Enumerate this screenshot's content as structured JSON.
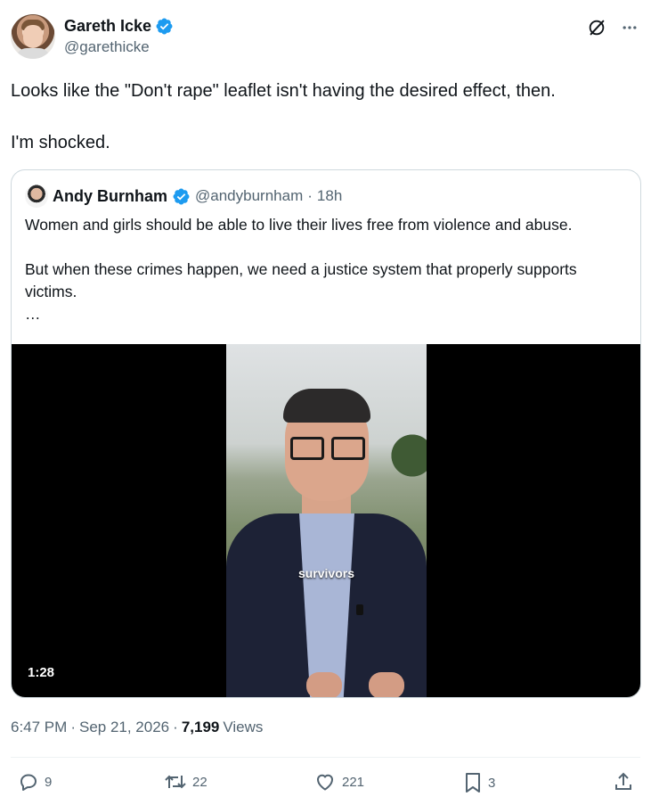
{
  "author": {
    "display_name": "Gareth Icke",
    "handle": "@garethicke"
  },
  "tweet": {
    "text": "Looks like the \"Don't rape\" leaflet isn't having the desired effect, then.\n\nI'm shocked."
  },
  "quoted": {
    "display_name": "Andy Burnham",
    "handle": "@andyburnham",
    "separator": "·",
    "age": "18h",
    "text": "Women and girls should be able to live their lives free from violence and abuse.\n\nBut when these crimes happen, we need a justice system that properly supports victims.\n…",
    "video": {
      "caption": "survivors",
      "duration": "1:28"
    }
  },
  "meta": {
    "time": "6:47 PM",
    "dot1": "·",
    "date": "Sep 21, 2026",
    "dot2": "·",
    "views_count": "7,199",
    "views_label": "Views"
  },
  "actions": {
    "replies": "9",
    "reposts": "22",
    "likes": "221",
    "bookmarks": "3"
  },
  "colors": {
    "verified_blue": "#1d9bf0",
    "text_primary": "#0f1419",
    "text_secondary": "#536471"
  },
  "icons": [
    "verified-badge-icon",
    "grok-icon",
    "more-icon",
    "reply-icon",
    "repost-icon",
    "like-icon",
    "bookmark-icon",
    "share-icon"
  ]
}
